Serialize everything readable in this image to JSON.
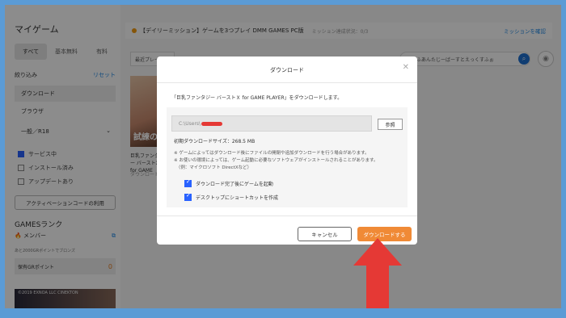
{
  "sidebar": {
    "title": "マイゲーム",
    "tabs": [
      "すべて",
      "基本無料",
      "有料"
    ],
    "filter_label": "絞り込み",
    "reset_label": "リセット",
    "items": [
      "ダウンロード",
      "ブラウザ"
    ],
    "rating_select": "一般／R18",
    "checks": [
      {
        "label": "サービス中",
        "checked": true
      },
      {
        "label": "インストール済み",
        "checked": false
      },
      {
        "label": "アップデートあり",
        "checked": false
      }
    ],
    "activation_button": "アクティベーションコードの利用",
    "rank_title": "GAMESランク",
    "member_label": "メンバー",
    "rank_note": "あと2000GRポイントでブロンズ",
    "points_label": "保有GRポイント",
    "points_value": "0",
    "banner_text": "©2019 EXNOA LLC CINEKTON"
  },
  "main": {
    "mission_title": "【デイリーミッション】ゲームを3つプレイ DMM GAMES PC版",
    "mission_progress": "ミッション達成状況：0/3",
    "mission_link": "ミッションを確認",
    "latest_label": "最近プレイ",
    "search_text": "ふうふあんたじーばーすとえっくすふぉ",
    "card_image_text": "試練の",
    "card_title": "巨乳ファンタジー バーストX for GAME",
    "card_sub": "ダウンロード"
  },
  "modal": {
    "title": "ダウンロード",
    "description": "「巨乳ファンタジー バーストＸ for GAME PLAYER」をダウンロードします。",
    "path_value": "C:\\Users\\",
    "browse_label": "参照",
    "size_text": "初期ダウンロードサイズ：268.5 MB",
    "notes": [
      "※ ゲームによってはダウンロード後にファイルの開閉や追加ダウンロードを行う場合があります。",
      "※ お使いの環境によっては、ゲーム起動に必要なソフトウェアがインストールされることがあります。",
      "　（例：マイクロソフト DirectXなど）"
    ],
    "options": [
      {
        "label": "ダウンロード完了後にゲームを起動",
        "checked": true
      },
      {
        "label": "デスクトップにショートカットを作成",
        "checked": true
      }
    ],
    "cancel_label": "キャンセル",
    "download_label": "ダウンロードする"
  },
  "colors": {
    "accent": "#f08a36",
    "annotation": "#e53935",
    "frame": "#5b9bd5"
  }
}
